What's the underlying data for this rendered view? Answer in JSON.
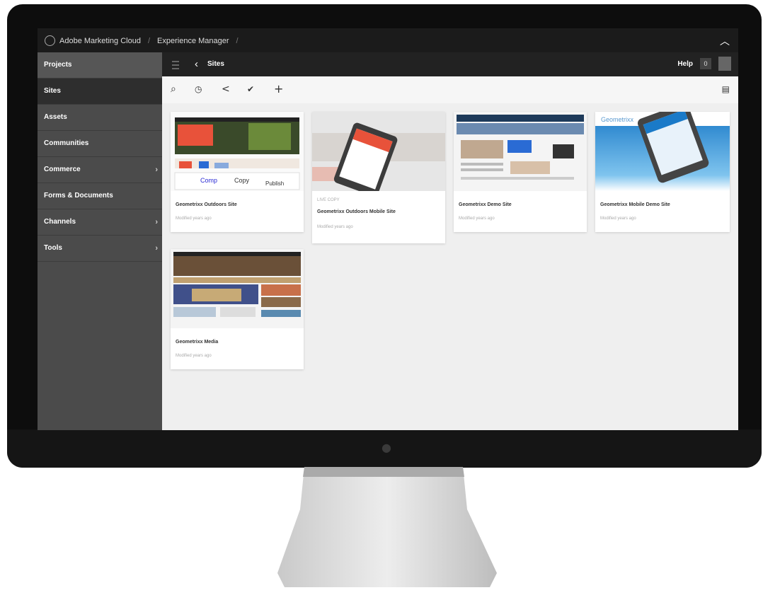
{
  "header": {
    "breadcrumb": [
      "Adobe Marketing Cloud",
      "Experience Manager"
    ],
    "separator": "/"
  },
  "sidebar": {
    "items": [
      {
        "label": "Projects",
        "chevron": false
      },
      {
        "label": "Sites",
        "chevron": false
      },
      {
        "label": "Assets",
        "chevron": false
      },
      {
        "label": "Communities",
        "chevron": false
      },
      {
        "label": "Commerce",
        "chevron": true
      },
      {
        "label": "Forms & Documents",
        "chevron": false
      },
      {
        "label": "Channels",
        "chevron": true
      },
      {
        "label": "Tools",
        "chevron": true
      }
    ]
  },
  "subbar": {
    "title": "Sites",
    "help": "Help",
    "notifications": "0"
  },
  "thumb_text": {
    "copy": "Copy",
    "publish": "Publish",
    "geometrixx": "Geometrixx"
  },
  "cards": [
    {
      "title": "Geometrixx Outdoors Site",
      "meta": "Modified years ago",
      "live": ""
    },
    {
      "title": "Geometrixx Outdoors Mobile Site",
      "meta": "Modified years ago",
      "live": "LIVE COPY"
    },
    {
      "title": "Geometrixx Demo Site",
      "meta": "Modified years ago",
      "live": ""
    },
    {
      "title": "Geometrixx Mobile Demo Site",
      "meta": "Modified years ago",
      "live": ""
    },
    {
      "title": "Geometrixx Media",
      "meta": "Modified years ago",
      "live": ""
    }
  ],
  "colors": {
    "sidebar": "#4b4b4b",
    "topbar": "#1b1b1b",
    "content": "#efefef",
    "accent": "#e8523a"
  }
}
